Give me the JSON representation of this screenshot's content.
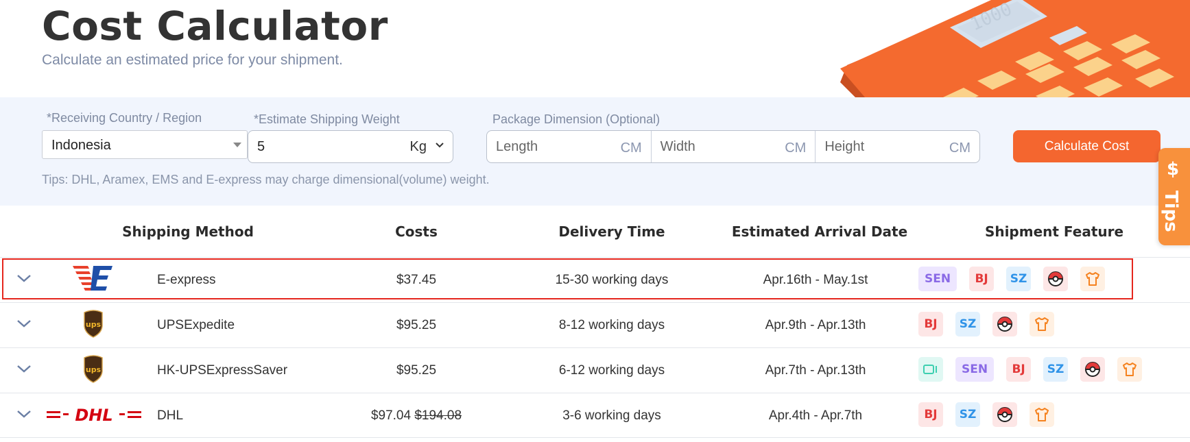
{
  "header": {
    "title": "Cost Calculator",
    "subtitle": "Calculate an estimated price for your shipment."
  },
  "form": {
    "country_label": "*Receiving Country / Region",
    "country_value": "Indonesia",
    "weight_label": "*Estimate Shipping Weight",
    "weight_value": "5",
    "weight_unit": "Kg",
    "dimension_label": "Package Dimension (Optional)",
    "length_placeholder": "Length",
    "width_placeholder": "Width",
    "height_placeholder": "Height",
    "dimension_unit": "CM",
    "calculate_button": "Calculate Cost",
    "tips": "Tips: DHL, Aramex, EMS and E-express may charge dimensional(volume) weight."
  },
  "side_tab": {
    "symbol": "$",
    "label": "Tips"
  },
  "table": {
    "headers": [
      "Shipping Method",
      "Costs",
      "Delivery Time",
      "Estimated Arrival Date",
      "Shipment Feature"
    ],
    "rows": [
      {
        "method": "E-express",
        "cost": "$37.45",
        "original_cost": "",
        "delivery": "15-30 working days",
        "arrival": "Apr.16th - May.1st",
        "features": [
          "SEN",
          "BJ",
          "SZ",
          "pokeball-icon",
          "shirt-icon"
        ]
      },
      {
        "method": "UPSExpedite",
        "cost": "$95.25",
        "original_cost": "",
        "delivery": "8-12 working days",
        "arrival": "Apr.9th - Apr.13th",
        "features": [
          "BJ",
          "SZ",
          "pokeball-icon",
          "shirt-icon"
        ]
      },
      {
        "method": "HK-UPSExpressSaver",
        "cost": "$95.25",
        "original_cost": "",
        "delivery": "6-12 working days",
        "arrival": "Apr.7th - Apr.13th",
        "features": [
          "video-icon",
          "SEN",
          "BJ",
          "SZ",
          "pokeball-icon",
          "shirt-icon"
        ]
      },
      {
        "method": "DHL",
        "cost": "$97.04",
        "original_cost": "$194.08",
        "delivery": "3-6 working days",
        "arrival": "Apr.4th - Apr.7th",
        "features": [
          "BJ",
          "SZ",
          "pokeball-icon",
          "shirt-icon"
        ]
      }
    ]
  },
  "colors": {
    "accent": "#f4662f",
    "form_background": "#f1f5fd",
    "highlight": "#e5261d"
  }
}
